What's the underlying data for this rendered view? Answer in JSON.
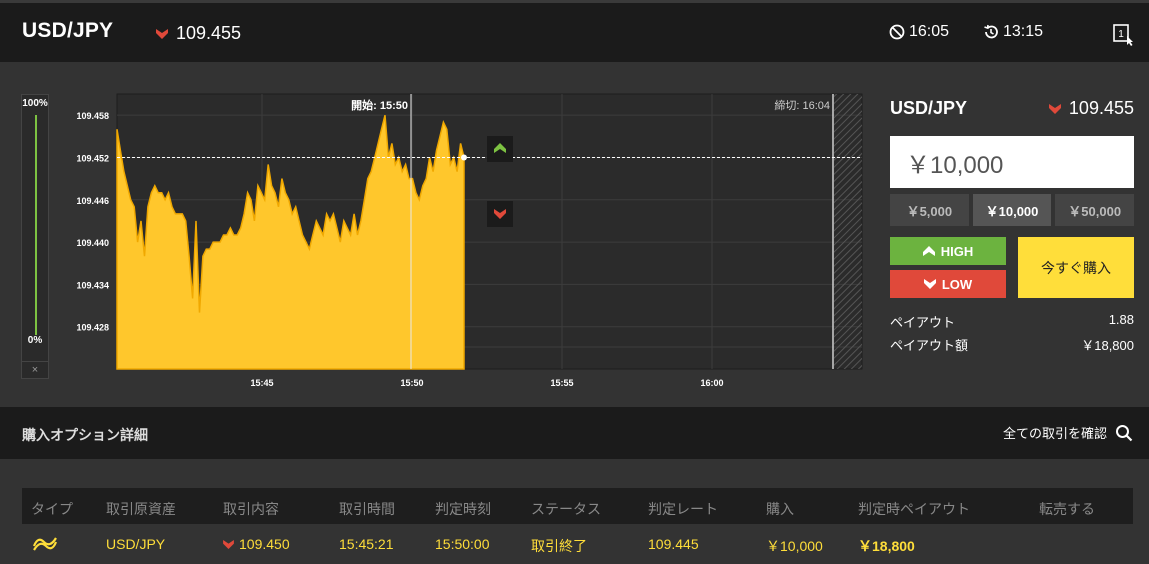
{
  "header": {
    "pair": "USD/JPY",
    "price": "109.455",
    "price_direction_icon": "down-triangle-icon",
    "timer1": "16:05",
    "timer2": "13:15"
  },
  "level_bar": {
    "top_label": "100%",
    "bottom_label": "0%",
    "close_label": "×"
  },
  "chart_data": {
    "type": "area",
    "y_ticks": [
      "109.458",
      "109.452",
      "109.446",
      "109.440",
      "109.434",
      "109.428"
    ],
    "x_ticks": [
      "15:45",
      "15:50",
      "15:55",
      "16:00"
    ],
    "start_label": "開始: 15:50",
    "end_label": "締切: 16:04",
    "current_rate": 109.452,
    "ylim": [
      109.422,
      109.461
    ],
    "area_color": "#ffc72c"
  },
  "order_panel": {
    "pair": "USD/JPY",
    "price": "109.455",
    "amount_value": "￥10,000",
    "presets": [
      {
        "label": "￥5,000",
        "active": false
      },
      {
        "label": "￥10,000",
        "active": true
      },
      {
        "label": "￥50,000",
        "active": false
      }
    ],
    "high_label": "HIGH",
    "low_label": "LOW",
    "buy_now_label": "今すぐ購入",
    "payout_label": "ペイアウト",
    "payout_value": "1.88",
    "payout_amount_label": "ペイアウト額",
    "payout_amount_value": "￥18,800"
  },
  "details": {
    "title": "購入オプション詳細",
    "view_all_label": "全ての取引を確認"
  },
  "table": {
    "headers": [
      "タイプ",
      "取引原資産",
      "取引内容",
      "取引時間",
      "判定時刻",
      "ステータス",
      "判定レート",
      "購入",
      "判定時ペイアウト",
      "転売する"
    ],
    "row": {
      "asset": "USD/JPY",
      "trade": "109.450",
      "trade_time": "15:45:21",
      "judge_time": "15:50:00",
      "status": "取引終了",
      "judge_rate": "109.445",
      "purchase": "￥10,000",
      "payout": "￥18,800"
    }
  },
  "colors": {
    "accent": "#ffde3a",
    "high": "#6cb33f",
    "low": "#e0493a"
  }
}
